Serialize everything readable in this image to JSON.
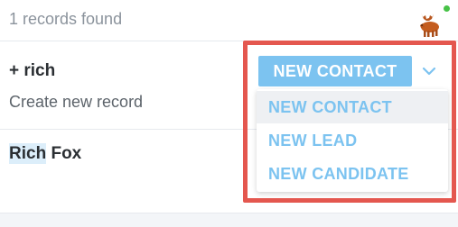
{
  "header": {
    "records_found": "1 records found",
    "avatar_icon": "moose-avatar-icon"
  },
  "create": {
    "query": "+ rich",
    "description": "Create new record"
  },
  "results": [
    {
      "highlight": "Rich",
      "rest": " Fox"
    }
  ],
  "new_record": {
    "primary_label": "NEW CONTACT",
    "toggle_icon": "chevron-down-icon",
    "options": [
      "NEW CONTACT",
      "NEW LEAD",
      "NEW CANDIDATE"
    ],
    "selected_index": 0
  },
  "colors": {
    "accent": "#7cc3f0",
    "highlight_frame": "#e4574f",
    "status_online": "#47c247"
  }
}
